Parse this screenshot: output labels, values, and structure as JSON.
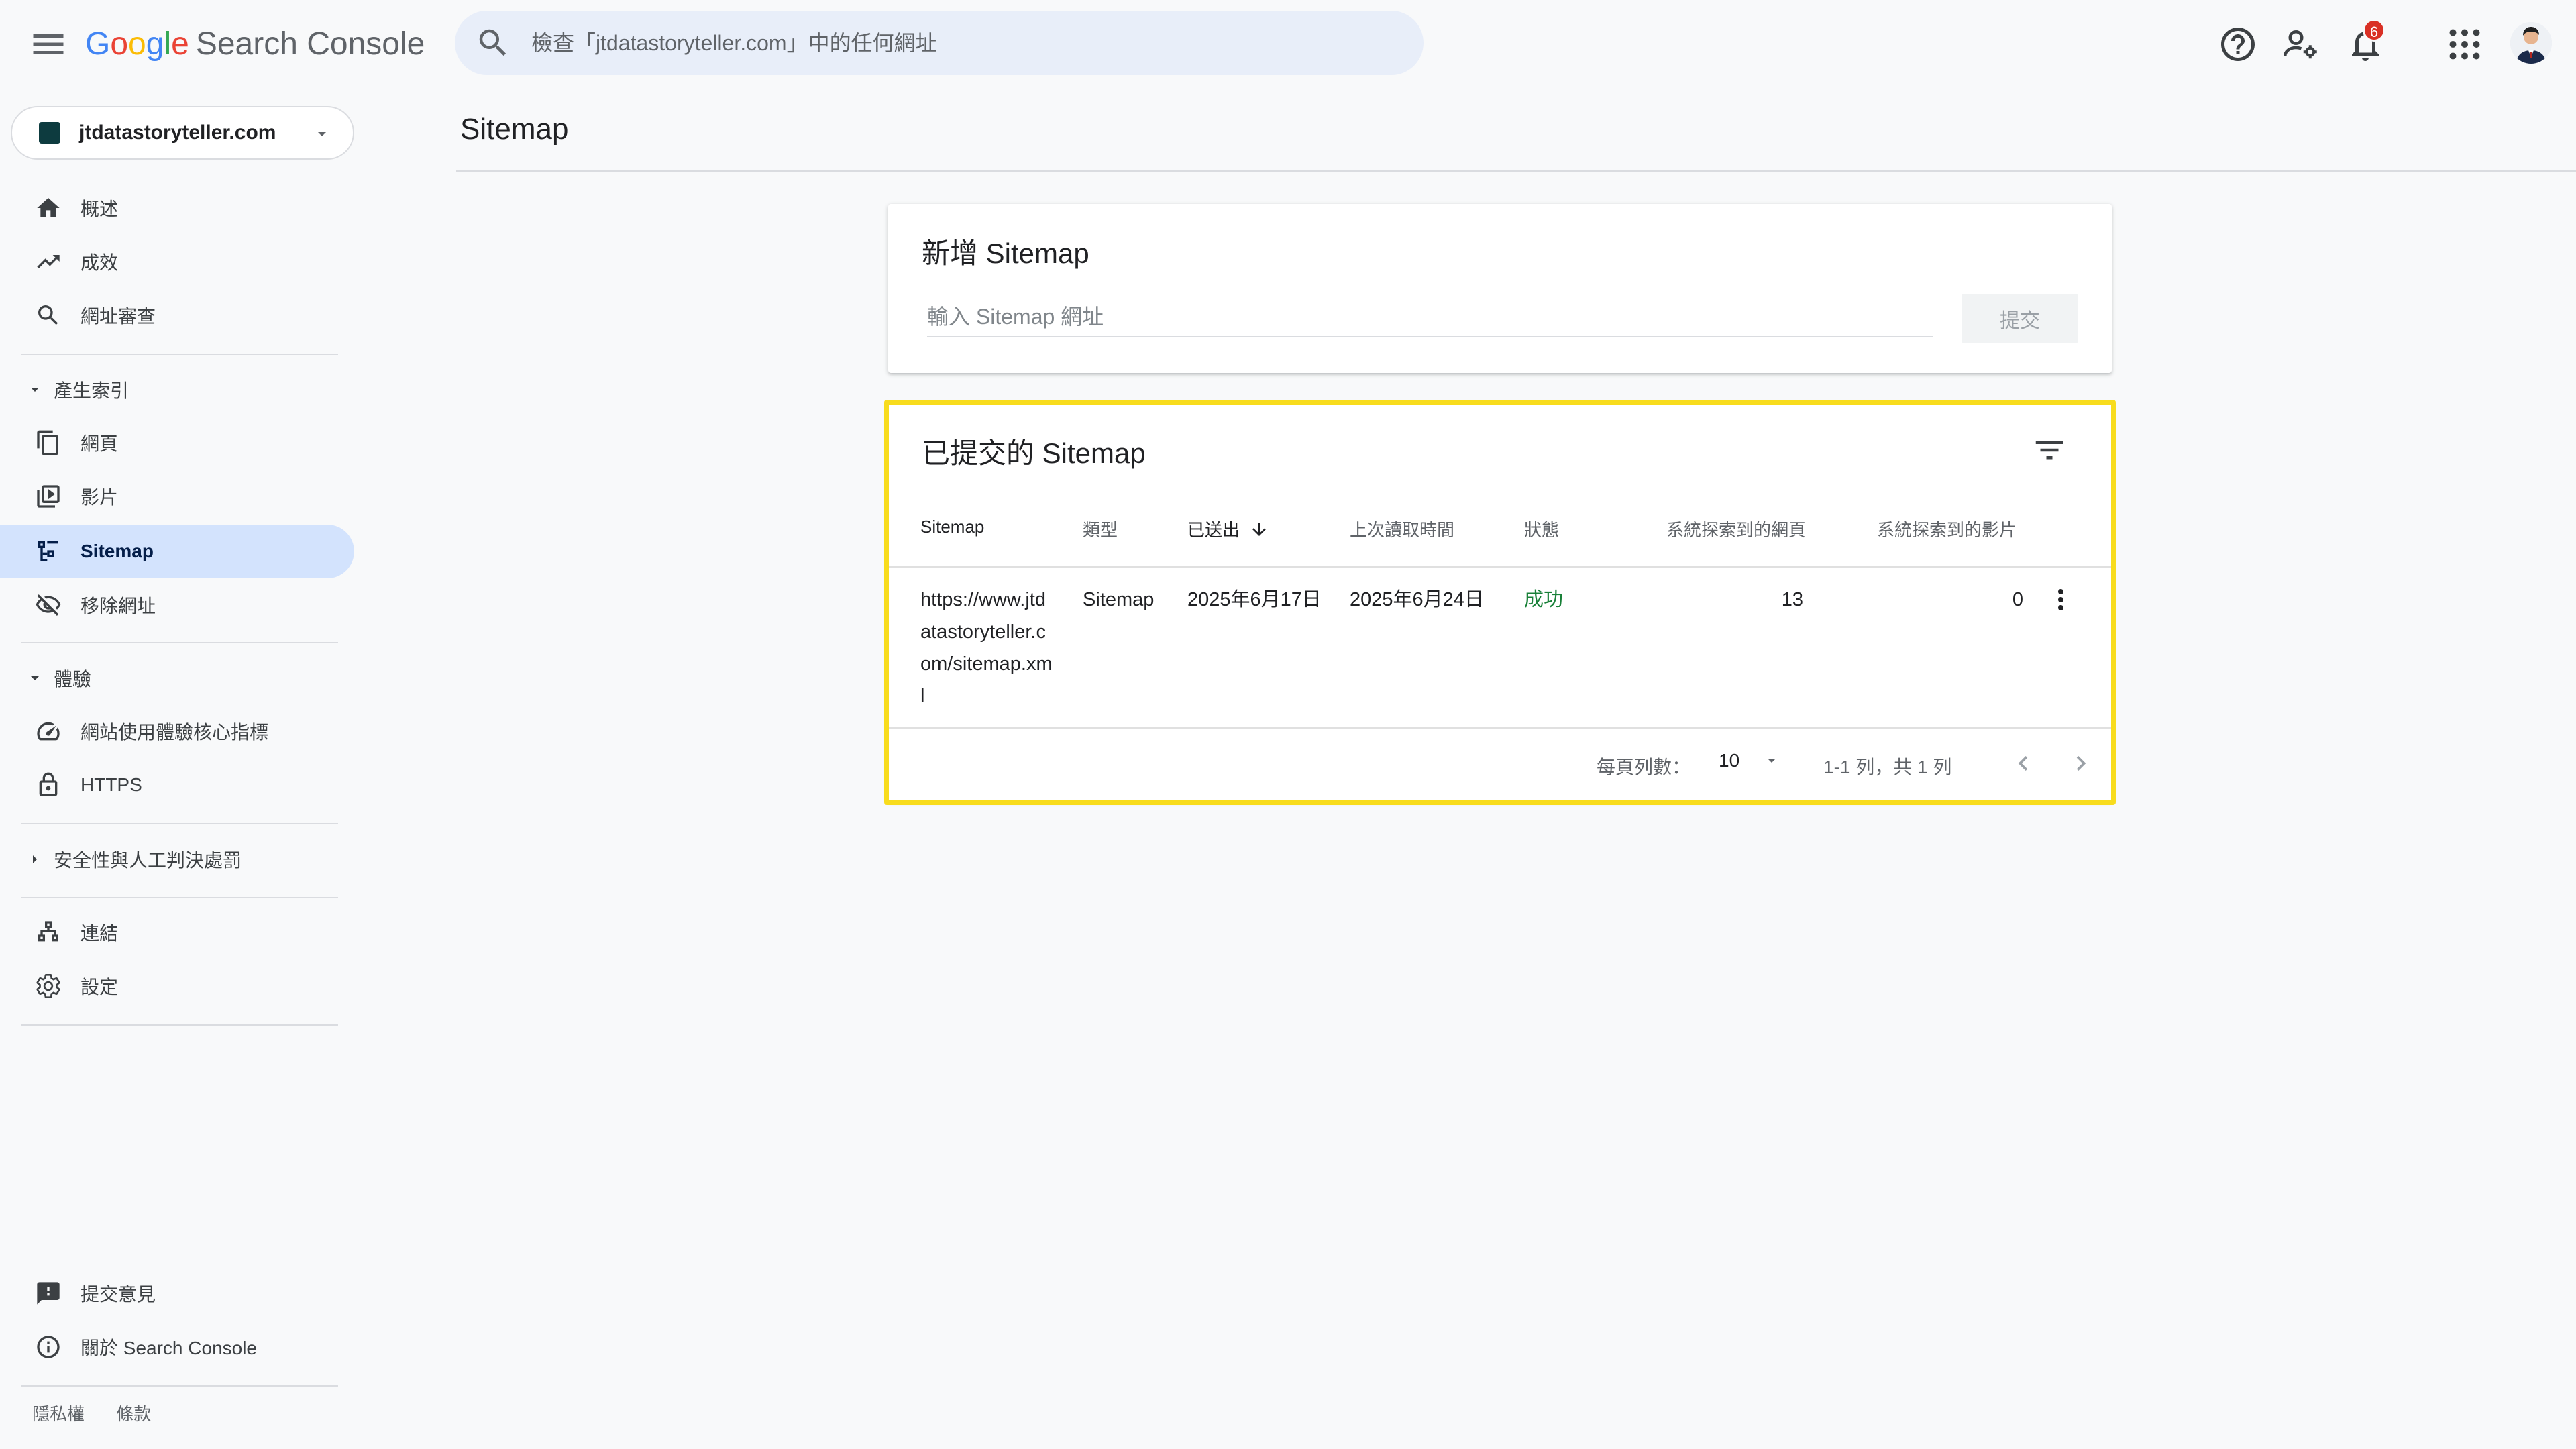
{
  "app": {
    "logo_letters": [
      "G",
      "o",
      "o",
      "g",
      "l",
      "e"
    ],
    "product": "Search Console",
    "search_placeholder": "檢查「jtdatastoryteller.com」中的任何網址",
    "notification_count": "6"
  },
  "sidebar": {
    "property": "jtdatastoryteller.com",
    "items": [
      {
        "label": "概述",
        "icon": "home-icon"
      },
      {
        "label": "成效",
        "icon": "trending-up-icon"
      },
      {
        "label": "網址審查",
        "icon": "search-icon"
      }
    ],
    "indexing": {
      "section": "產生索引",
      "items": [
        {
          "label": "網頁",
          "icon": "pages-icon"
        },
        {
          "label": "影片",
          "icon": "video-icon"
        },
        {
          "label": "Sitemap",
          "icon": "sitemap-icon"
        },
        {
          "label": "移除網址",
          "icon": "visibility-off-icon"
        }
      ]
    },
    "experience": {
      "section": "體驗",
      "items": [
        {
          "label": "網站使用體驗核心指標",
          "icon": "speed-icon"
        },
        {
          "label": "HTTPS",
          "icon": "lock-icon"
        }
      ]
    },
    "security": {
      "section": "安全性與人工判決處罰"
    },
    "other": [
      {
        "label": "連結",
        "icon": "links-icon"
      },
      {
        "label": "設定",
        "icon": "gear-icon"
      }
    ],
    "bottom": [
      {
        "label": "提交意見",
        "icon": "feedback-icon"
      },
      {
        "label": "關於 Search Console",
        "icon": "info-icon"
      }
    ],
    "footer": {
      "privacy": "隱私權",
      "terms": "條款"
    }
  },
  "main": {
    "title": "Sitemap",
    "add_card": {
      "heading": "新增 Sitemap",
      "input_placeholder": "輸入 Sitemap 網址",
      "submit_label": "提交"
    },
    "list_card": {
      "heading": "已提交的 Sitemap",
      "columns": [
        "Sitemap",
        "類型",
        "已送出",
        "上次讀取時間",
        "狀態",
        "系統探索到的網頁",
        "系統探索到的影片"
      ],
      "rows": [
        {
          "sitemap": "https://www.jtdatastoryteller.com/sitemap.xml",
          "type": "Sitemap",
          "submitted": "2025年6月17日",
          "last_read": "2025年6月24日",
          "status": "成功",
          "pages": "13",
          "videos": "0"
        }
      ],
      "rows_per_page_label": "每頁列數：",
      "rows_per_page": "10",
      "range": "1-1 列，共 1 列"
    }
  },
  "colors": {
    "active_nav": "#d3e3fd",
    "success": "#188038",
    "highlight": "#f8dc1d",
    "badge": "#d93025"
  }
}
